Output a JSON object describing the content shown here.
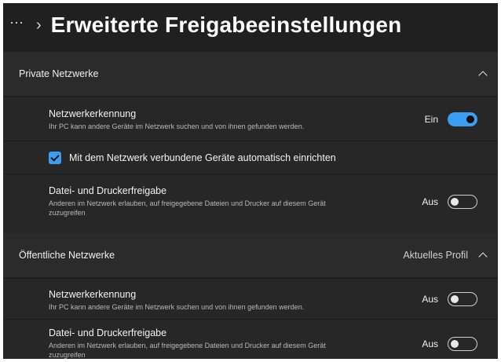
{
  "header": {
    "more_icon": "⋯",
    "chevron": "›",
    "title": "Erweiterte Freigabeeinstellungen"
  },
  "private": {
    "title": "Private Netzwerke",
    "discovery": {
      "label": "Netzwerkerkennung",
      "description": "Ihr PC kann andere Geräte im Netzwerk suchen und von ihnen gefunden werden.",
      "state": "Ein",
      "on": true
    },
    "auto_setup": {
      "label": "Mit dem Netzwerk verbundene Geräte automatisch einrichten",
      "checked": true
    },
    "sharing": {
      "label": "Datei- und Druckerfreigabe",
      "description_line1": "Anderen im Netzwerk erlauben, auf freigegebene Dateien und Drucker auf diesem Gerät",
      "description_line2": "zuzugreifen",
      "state": "Aus",
      "on": false
    }
  },
  "public": {
    "title": "Öffentliche Netzwerke",
    "profile_label": "Aktuelles Profil",
    "discovery": {
      "label": "Netzwerkerkennung",
      "description": "Ihr PC kann andere Geräte im Netzwerk suchen und von ihnen gefunden werden.",
      "state": "Aus",
      "on": false
    },
    "sharing": {
      "label": "Datei- und Druckerfreigabe",
      "description_line1": "Anderen im Netzwerk erlauben, auf freigegebene Dateien und Drucker auf diesem Gerät",
      "description_line2": "zuzugreifen",
      "state": "Aus",
      "on": false
    }
  },
  "colors": {
    "background": "#202020",
    "card": "#272727",
    "accent": "#3a9ff2"
  }
}
